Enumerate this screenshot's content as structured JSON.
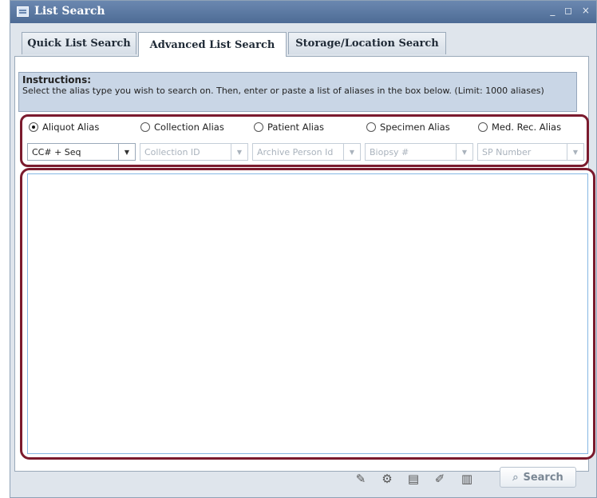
{
  "window": {
    "title": "List Search",
    "controls": "_ ◻ ×"
  },
  "tabs": [
    {
      "label": "Quick List Search"
    },
    {
      "label": "Advanced List Search"
    },
    {
      "label": "Storage/Location Search"
    }
  ],
  "instructions": {
    "heading": "Instructions:",
    "text": "Select the alias type you wish to search on. Then, enter or paste a list of aliases in the box below. (Limit: 1000 aliases)"
  },
  "alias_options": [
    {
      "label": "Aliquot Alias",
      "selected": true
    },
    {
      "label": "Collection Alias",
      "selected": false
    },
    {
      "label": "Patient Alias",
      "selected": false
    },
    {
      "label": "Specimen Alias",
      "selected": false
    },
    {
      "label": "Med. Rec. Alias",
      "selected": false
    }
  ],
  "alias_selects": [
    {
      "value": "CC# + Seq",
      "enabled": true
    },
    {
      "value": "Collection ID",
      "enabled": false
    },
    {
      "value": "Archive Person Id",
      "enabled": false
    },
    {
      "value": "Biopsy #",
      "enabled": false
    },
    {
      "value": "SP Number",
      "enabled": false
    }
  ],
  "alias_list": {
    "value": ""
  },
  "footer": {
    "icons": [
      "pencil-icon",
      "filter-icon",
      "list-icon",
      "edit-icon",
      "barcode-icon"
    ],
    "search_label": "Search"
  },
  "colors": {
    "highlight": "#7b1b2e",
    "titlebar": "#5674a0",
    "instructions_bg": "#c9d6e6"
  }
}
